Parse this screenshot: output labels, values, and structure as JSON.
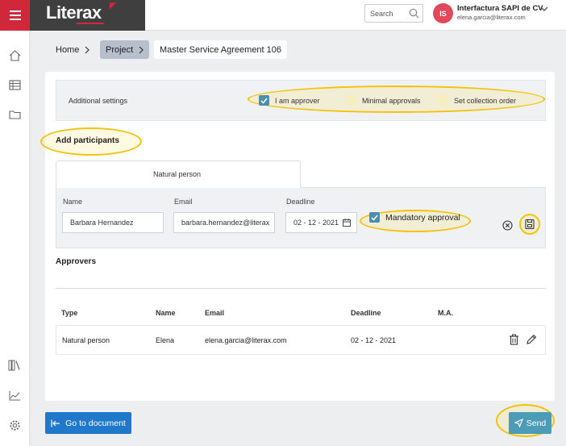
{
  "header": {
    "logo_text": "Literax",
    "search_placeholder": "Search",
    "user_initials": "IS",
    "company": "Interfactura SAPI de CV",
    "email": "elena.garcia@literax.com"
  },
  "breadcrumb": {
    "home": "Home",
    "project": "Project",
    "current": "Master Service Agreement 106"
  },
  "settings": {
    "label": "Additional settings",
    "options": [
      {
        "label": "I am approver",
        "checked": true
      },
      {
        "label": "Minimal approvals",
        "checked": false
      },
      {
        "label": "Set collection order",
        "checked": false
      }
    ]
  },
  "participants": {
    "heading": "Add participants",
    "tab": "Natural person",
    "name_label": "Name",
    "name_value": "Barbara Hernandez",
    "email_label": "Email",
    "email_value": "barbara.hernandez@literax",
    "deadline_label": "Deadline",
    "deadline_value": "02 - 12 - 2021",
    "mandatory_label": "Mandatory approval",
    "mandatory_checked": true
  },
  "approvers": {
    "heading": "Approvers",
    "columns": [
      "Type",
      "Name",
      "Email",
      "Deadline",
      "M.A."
    ],
    "rows": [
      {
        "type": "Natural person",
        "name": "Elena",
        "email": "elena.garcia@literax.com",
        "deadline": "02 - 12 - 2021",
        "ma": ""
      }
    ]
  },
  "footer": {
    "go_to_document": "Go to document",
    "send": "Send"
  },
  "colors": {
    "brand_red": "#d0273a",
    "primary_blue": "#1f78c9",
    "send_teal": "#4c9cb8",
    "highlight_yellow": "#f4c20d"
  }
}
